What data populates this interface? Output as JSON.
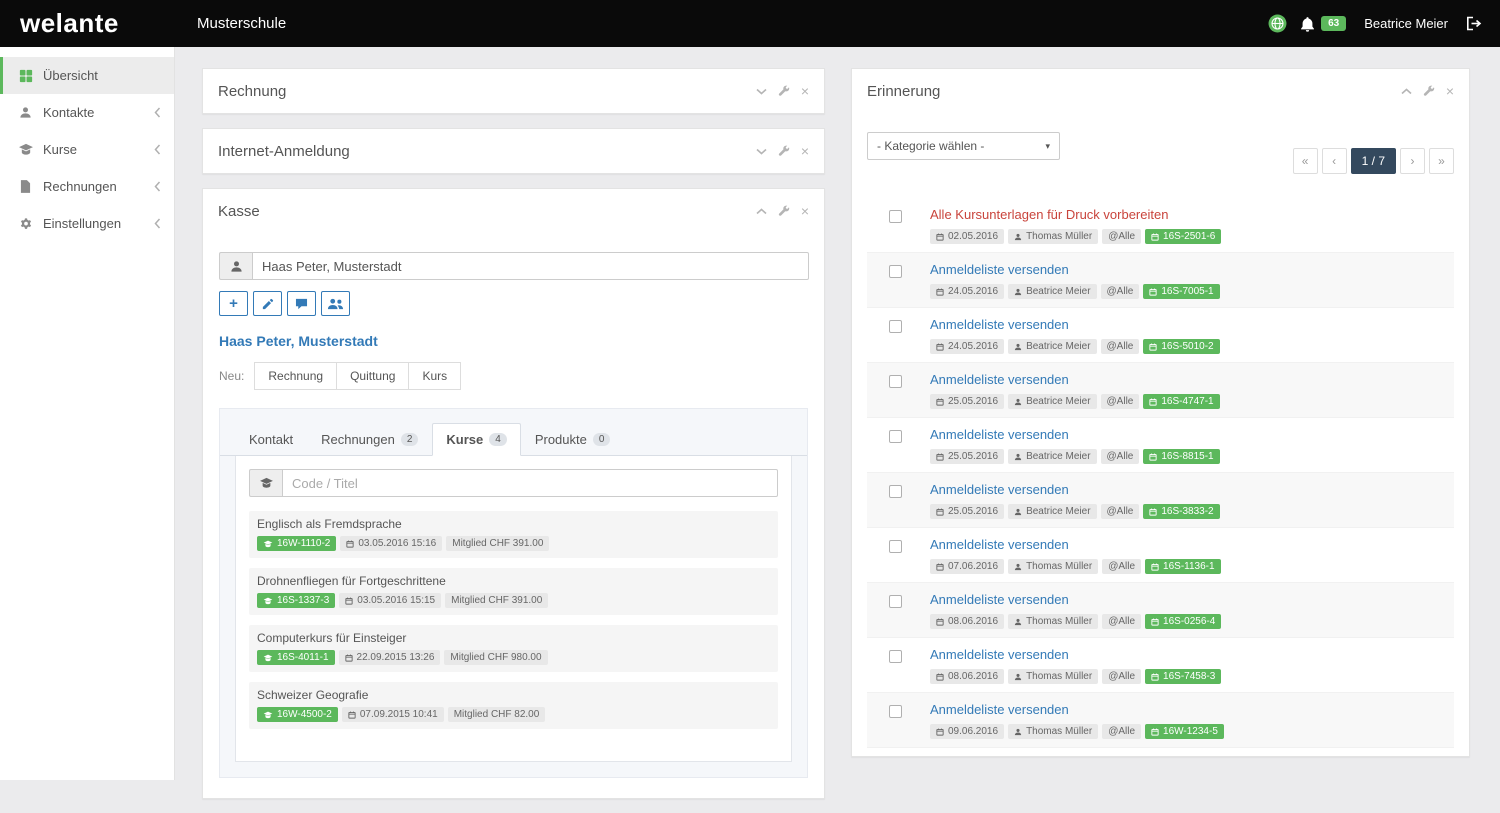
{
  "topbar": {
    "logo": "welante",
    "school": "Musterschule",
    "notification_count": "63",
    "user": "Beatrice Meier"
  },
  "icons": {
    "close": "×",
    "plus": "+",
    "caret": "▾"
  },
  "sidebar": {
    "items": [
      {
        "label": "Übersicht",
        "icon": "grid-icon"
      },
      {
        "label": "Kontakte",
        "icon": "user-icon"
      },
      {
        "label": "Kurse",
        "icon": "graduation-cap-icon"
      },
      {
        "label": "Rechnungen",
        "icon": "file-icon"
      },
      {
        "label": "Einstellungen",
        "icon": "gears-icon"
      }
    ]
  },
  "panels": {
    "rechnung": {
      "title": "Rechnung"
    },
    "internet_anmeldung": {
      "title": "Internet-Anmeldung"
    },
    "kasse": {
      "title": "Kasse",
      "search_value": "Haas Peter, Musterstadt",
      "contact_link": "Haas Peter, Musterstadt",
      "neu_label": "Neu:",
      "neu_buttons": [
        "Rechnung",
        "Quittung",
        "Kurs"
      ],
      "tabs": [
        {
          "label": "Kontakt"
        },
        {
          "label": "Rechnungen",
          "count": "2"
        },
        {
          "label": "Kurse",
          "count": "4"
        },
        {
          "label": "Produkte",
          "count": "0"
        }
      ],
      "course_search_placeholder": "Code / Titel",
      "courses": [
        {
          "title": "Englisch als Fremdsprache",
          "code": "16W-1110-2",
          "date": "03.05.2016 15:16",
          "price": "Mitglied CHF 391.00"
        },
        {
          "title": "Drohnenfliegen für Fortgeschrittene",
          "code": "16S-1337-3",
          "date": "03.05.2016 15:15",
          "price": "Mitglied CHF 391.00"
        },
        {
          "title": "Computerkurs für Einsteiger",
          "code": "16S-4011-1",
          "date": "22.09.2015 13:26",
          "price": "Mitglied CHF 980.00"
        },
        {
          "title": "Schweizer Geografie",
          "code": "16W-4500-2",
          "date": "07.09.2015 10:41",
          "price": "Mitglied CHF 82.00"
        }
      ]
    },
    "erinnerung": {
      "title": "Erinnerung",
      "category_placeholder": "- Kategorie wählen -",
      "pagination": {
        "first": "«",
        "prev": "‹",
        "current": "1 / 7",
        "next": "›",
        "last": "»"
      },
      "reminders": [
        {
          "title": "Alle Kursunterlagen für Druck vorbereiten",
          "style": "title-danger",
          "date": "02.05.2016",
          "person": "Thomas Müller",
          "audience": "@Alle",
          "code": "16S-2501-6"
        },
        {
          "title": "Anmeldeliste versenden",
          "style": "title-link",
          "date": "24.05.2016",
          "person": "Beatrice Meier",
          "audience": "@Alle",
          "code": "16S-7005-1"
        },
        {
          "title": "Anmeldeliste versenden",
          "style": "title-link",
          "date": "24.05.2016",
          "person": "Beatrice Meier",
          "audience": "@Alle",
          "code": "16S-5010-2"
        },
        {
          "title": "Anmeldeliste versenden",
          "style": "title-link",
          "date": "25.05.2016",
          "person": "Beatrice Meier",
          "audience": "@Alle",
          "code": "16S-4747-1"
        },
        {
          "title": "Anmeldeliste versenden",
          "style": "title-link",
          "date": "25.05.2016",
          "person": "Beatrice Meier",
          "audience": "@Alle",
          "code": "16S-8815-1"
        },
        {
          "title": "Anmeldeliste versenden",
          "style": "title-link",
          "date": "25.05.2016",
          "person": "Beatrice Meier",
          "audience": "@Alle",
          "code": "16S-3833-2"
        },
        {
          "title": "Anmeldeliste versenden",
          "style": "title-link",
          "date": "07.06.2016",
          "person": "Thomas Müller",
          "audience": "@Alle",
          "code": "16S-1136-1"
        },
        {
          "title": "Anmeldeliste versenden",
          "style": "title-link",
          "date": "08.06.2016",
          "person": "Thomas Müller",
          "audience": "@Alle",
          "code": "16S-0256-4"
        },
        {
          "title": "Anmeldeliste versenden",
          "style": "title-link",
          "date": "08.06.2016",
          "person": "Thomas Müller",
          "audience": "@Alle",
          "code": "16S-7458-3"
        },
        {
          "title": "Anmeldeliste versenden",
          "style": "title-link",
          "date": "09.06.2016",
          "person": "Thomas Müller",
          "audience": "@Alle",
          "code": "16W-1234-5"
        }
      ]
    }
  }
}
